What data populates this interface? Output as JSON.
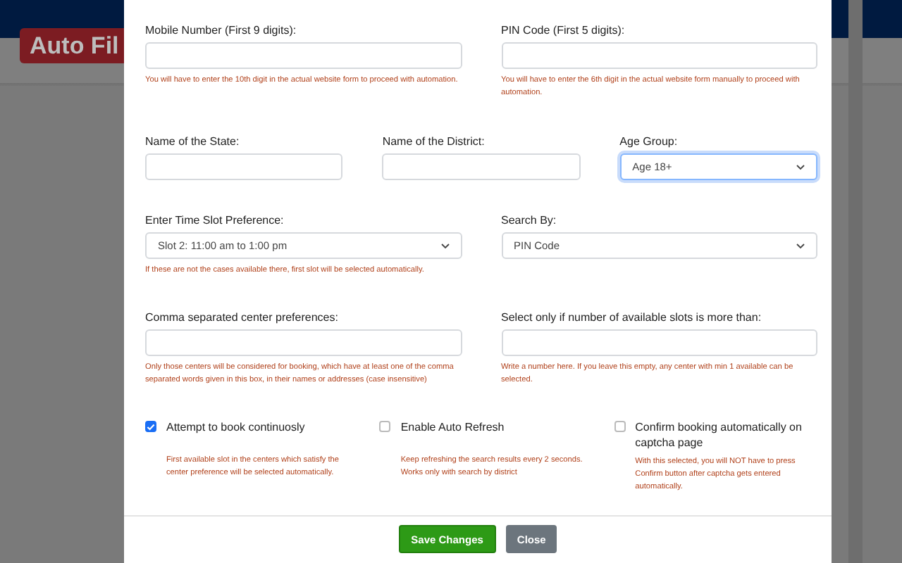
{
  "background": {
    "app_button": "Auto Fil"
  },
  "modal": {
    "rows": [
      {
        "fields": [
          {
            "kind": "input",
            "label": "Mobile Number (First 9 digits):",
            "focused": false,
            "help": "You will have to enter the 10th digit in the actual website form to proceed with automation."
          },
          {
            "kind": "input",
            "label": "PIN Code (First 5 digits):",
            "focused": false,
            "help": "You will have to enter the 6th digit in the actual website form manually to proceed with automation."
          }
        ]
      },
      {
        "fields": [
          {
            "kind": "input",
            "label": "Name of the State:",
            "focused": false
          },
          {
            "kind": "input",
            "label": "Name of the District:",
            "focused": false
          },
          {
            "kind": "select",
            "label": "Age Group:",
            "value": "Age 18+",
            "focused": true
          }
        ]
      },
      {
        "fields": [
          {
            "kind": "select",
            "label": "Enter Time Slot Preference:",
            "value": "Slot 2: 11:00 am to 1:00 pm",
            "focused": false,
            "help": "If these are not the cases available there, first slot will be selected automatically."
          },
          {
            "kind": "select",
            "label": "Search By:",
            "value": "PIN Code",
            "focused": false
          }
        ]
      },
      {
        "fields": [
          {
            "kind": "input",
            "label": "Comma separated center preferences:",
            "focused": false,
            "help": "Only those centers will be considered for booking, which have at least one of the comma separated words given in this box, in their names or addresses (case insensitive)"
          },
          {
            "kind": "input",
            "label": "Select only if number of available slots is more than:",
            "focused": false,
            "help": "Write a number here. If you leave this empty, any center with min 1 available can be selected."
          }
        ]
      }
    ],
    "checkboxes": [
      {
        "label": "Attempt to book continuosly",
        "checked": true,
        "help": "First available slot in the centers which satisfy the center preference will be selected automatically."
      },
      {
        "label": "Enable Auto Refresh",
        "checked": false,
        "help": "Keep refreshing the search results every 2 seconds. Works only with search by district"
      },
      {
        "label": "Confirm booking automatically on captcha page",
        "checked": false,
        "help": "With this selected, you will NOT have to press Confirm button after captcha gets entered automatically."
      }
    ],
    "buttons": [
      {
        "label": "Save Changes",
        "kind": "primary"
      },
      {
        "label": "Close",
        "kind": "secondary"
      }
    ]
  }
}
